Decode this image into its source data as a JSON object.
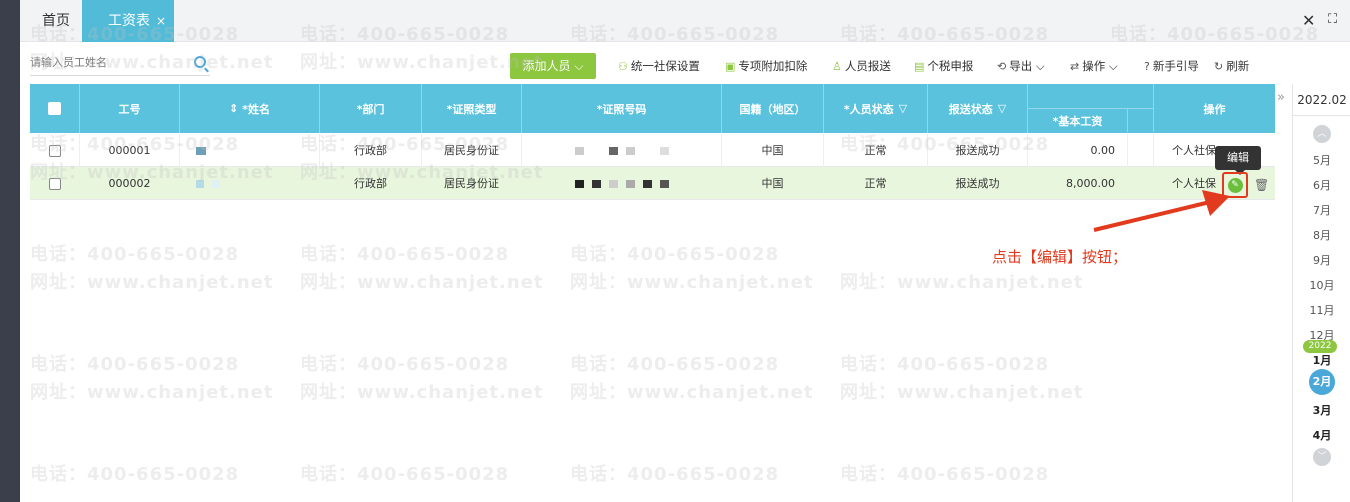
{
  "tabs": {
    "home": "首页",
    "active": "工资表",
    "close_glyph": "×"
  },
  "window": {
    "close_glyph": "✕",
    "fullscreen_glyph": "⛶"
  },
  "search": {
    "placeholder": "请输入员工姓名",
    "icon": "search-icon"
  },
  "toolbar": {
    "add_person": "添加人员",
    "unified_social": "统一社保设置",
    "special_deduction": "专项附加扣除",
    "person_report": "人员报送",
    "tax_declare": "个税申报",
    "export": "导出",
    "operation": "操作",
    "guide": "新手引导",
    "refresh": "刷新"
  },
  "table": {
    "headers": {
      "emp_no": "工号",
      "name": "*姓名",
      "dept": "*部门",
      "id_type": "*证照类型",
      "id_no": "*证照号码",
      "nationality": "国籍（地区）",
      "status": "*人员状态",
      "report_status": "报送状态",
      "base_salary": "*基本工资",
      "actions": "操作"
    },
    "rows": [
      {
        "emp_no": "000001",
        "dept": "行政部",
        "id_type": "居民身份证",
        "nationality": "中国",
        "status": "正常",
        "report_status": "报送成功",
        "base_salary": "0.00",
        "social": "个人社保"
      },
      {
        "emp_no": "000002",
        "dept": "行政部",
        "id_type": "居民身份证",
        "nationality": "中国",
        "status": "正常",
        "report_status": "报送成功",
        "base_salary": "8,000.00",
        "social": "个人社保"
      }
    ]
  },
  "tooltip": {
    "edit": "编辑"
  },
  "annotation": "点击【编辑】按钮；",
  "period": {
    "current": "2022.02",
    "year_badge": "2022",
    "months": [
      "5月",
      "6月",
      "7月",
      "8月",
      "9月",
      "10月",
      "11月",
      "12月",
      "1月",
      "2月",
      "3月",
      "4月"
    ]
  },
  "watermark": {
    "phone": "电话：400-665-0028",
    "site": "网址：www.chanjet.net"
  },
  "colors": {
    "header": "#5bc2de",
    "accent_green": "#8dc63f",
    "highlight": "#e23a1e",
    "tab_active": "#52bbd8"
  }
}
